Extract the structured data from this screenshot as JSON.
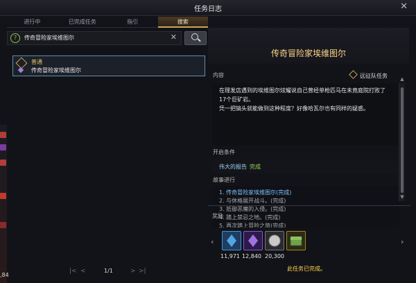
{
  "window": {
    "title": "任务日志"
  },
  "tabs": [
    {
      "label": "进行中"
    },
    {
      "label": "已完成任务"
    },
    {
      "label": "指引"
    },
    {
      "label": "搜索"
    }
  ],
  "search": {
    "value": "传奇冒险家埃维图尔",
    "help": "?"
  },
  "results": [
    {
      "type": "普通",
      "name": "传奇冒险家埃维图尔"
    }
  ],
  "pager": {
    "page": "1/1"
  },
  "quest": {
    "title": "传奇冒险家埃维图尔",
    "content_label": "内容",
    "expedition_label": "远征队任务",
    "content_lines": [
      "在理发店遇到的埃维图尔炫耀说自己曾经单枪匹马在未竟庭院打败了",
      "17个巨矿岩。",
      "凭一把镐头就能做到这种程度？好像哈瓦尔也有同样的疑惑。"
    ],
    "condition_label": "开启条件",
    "condition_name": "伟大的报告",
    "condition_status": "完成",
    "story_label": "故事进行",
    "story_lines": [
      "1. 传奇冒险家埃维图尔(完成)",
      "2. 与休格展开战斗。(完成)",
      "3. 抵御恶魔的入侵。(完成)",
      "4. 踏上禁忌之地。(完成)",
      "5. 再次踏上冒险之旅(完成)"
    ],
    "reward_label": "奖励",
    "rewards": [
      {
        "value": "11,971",
        "icon": "blue-shard-icon",
        "color": "#3a9ad9"
      },
      {
        "value": "12,840",
        "icon": "purple-shard-icon",
        "color": "#8a54d6"
      },
      {
        "value": "20,300",
        "icon": "silver-coin-icon",
        "color": "#b7b7b7"
      },
      {
        "value": "",
        "icon": "chest-icon",
        "color": "#5c8a3a"
      }
    ],
    "completed_text": "此任务已完成。"
  },
  "game_left": {
    "fragment": ",84"
  }
}
